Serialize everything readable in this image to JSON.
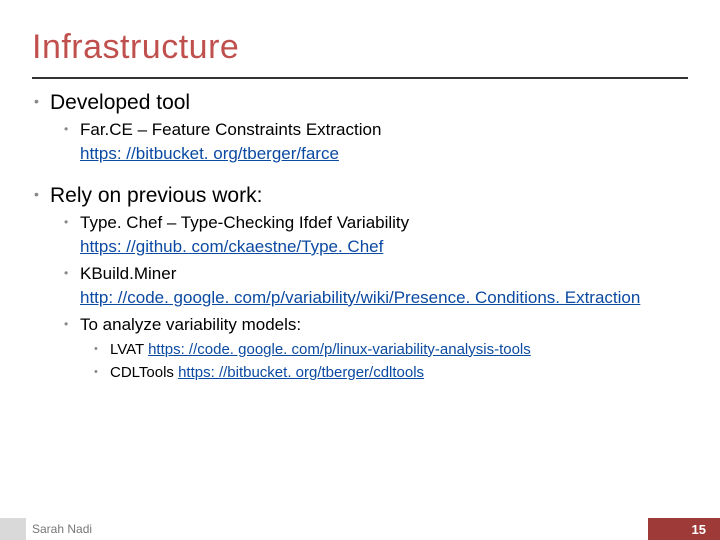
{
  "title": "Infrastructure",
  "b1": {
    "heading": "Developed tool",
    "item1_text": "Far.CE – Feature Constraints Extraction",
    "item1_link": "https: //bitbucket. org/tberger/farce"
  },
  "b2": {
    "heading": "Rely on previous work:",
    "item1_text": "Type. Chef – Type-Checking Ifdef Variability",
    "item1_link": "https: //github. com/ckaestne/Type. Chef",
    "item2_text": "KBuild.Miner",
    "item2_link": "http: //code. google. com/p/variability/wiki/Presence. Conditions. Extraction",
    "item3_text": "To analyze variability models:",
    "sub1_label": "LVAT ",
    "sub1_link": "https: //code. google. com/p/linux-variability-analysis-tools",
    "sub2_label": "CDLTools ",
    "sub2_link": "https: //bitbucket. org/tberger/cdltools"
  },
  "footer": {
    "author": "Sarah Nadi",
    "page": "15"
  }
}
